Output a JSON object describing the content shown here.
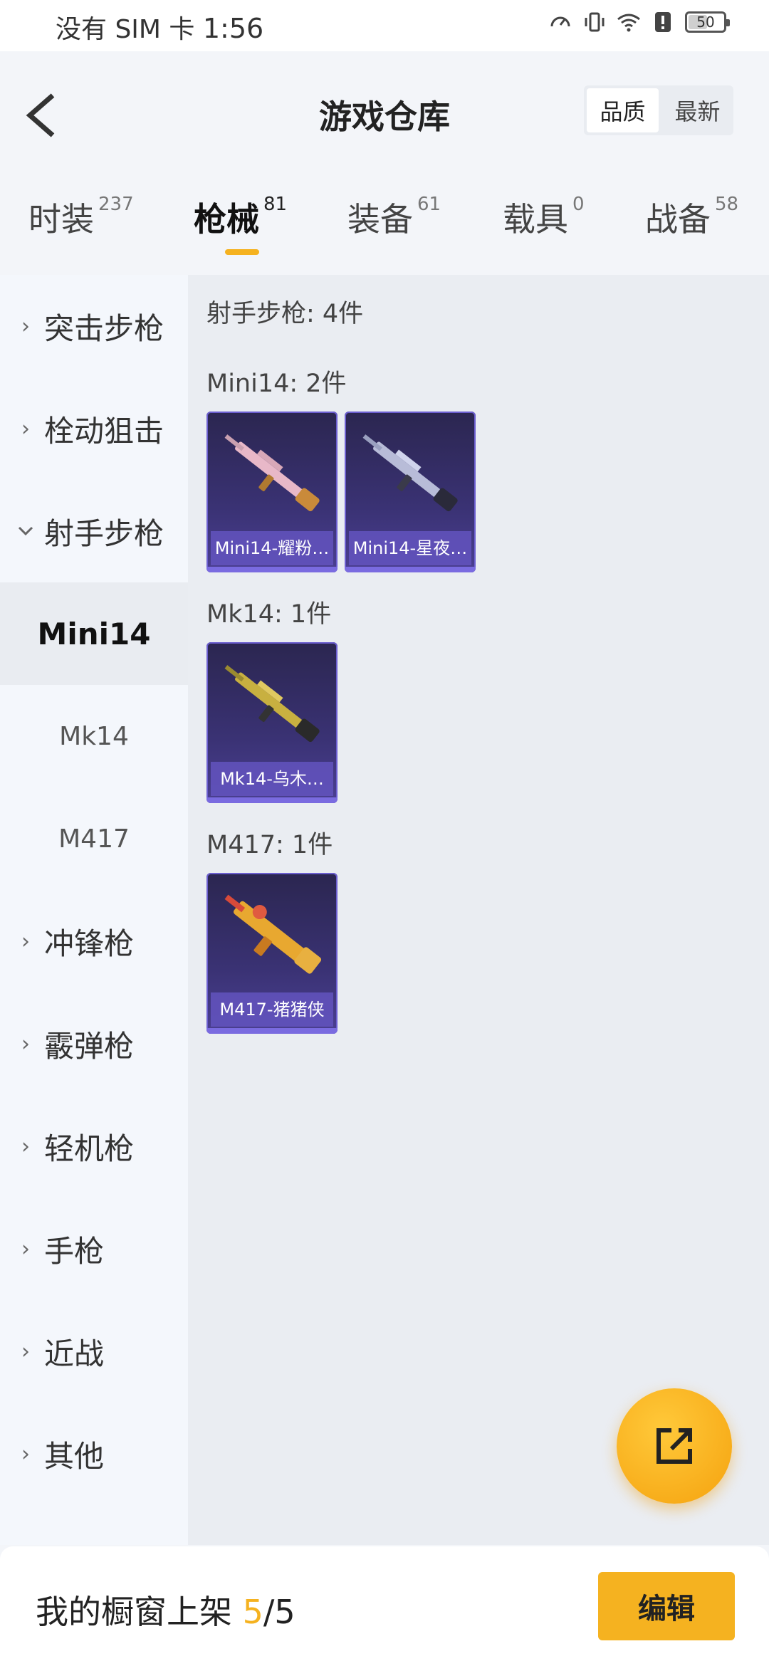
{
  "status_bar": {
    "carrier": "没有 SIM 卡",
    "time": "1:56",
    "battery": "50",
    "icons": [
      "speed-icon",
      "vibrate-icon",
      "wifi-icon",
      "alert-icon"
    ]
  },
  "header": {
    "title": "游戏仓库",
    "sort_options": [
      "品质",
      "最新"
    ],
    "sort_selected": "品质"
  },
  "tabs": [
    {
      "label": "时装",
      "count": "237"
    },
    {
      "label": "枪械",
      "count": "81",
      "active": true
    },
    {
      "label": "装备",
      "count": "61"
    },
    {
      "label": "载具",
      "count": "0"
    },
    {
      "label": "战备",
      "count": "58"
    }
  ],
  "sidebar": {
    "items": [
      {
        "label": "突击步枪",
        "expanded": false
      },
      {
        "label": "栓动狙击",
        "expanded": false
      },
      {
        "label": "射手步枪",
        "expanded": true
      },
      {
        "label": "冲锋枪",
        "expanded": false
      },
      {
        "label": "霰弹枪",
        "expanded": false
      },
      {
        "label": "轻机枪",
        "expanded": false
      },
      {
        "label": "手枪",
        "expanded": false
      },
      {
        "label": "近战",
        "expanded": false
      },
      {
        "label": "其他",
        "expanded": false
      }
    ],
    "sub_items": [
      {
        "label": "Mini14",
        "active": true
      },
      {
        "label": "Mk14"
      },
      {
        "label": "M417"
      }
    ]
  },
  "content": {
    "summary": "射手步枪: 4件",
    "groups": [
      {
        "title": "Mini14: 2件",
        "items": [
          "Mini14-耀粉…",
          "Mini14-星夜…"
        ]
      },
      {
        "title": "Mk14: 1件",
        "items": [
          "Mk14-乌木…"
        ]
      },
      {
        "title": "M417: 1件",
        "items": [
          "M417-猪猪侠"
        ]
      }
    ]
  },
  "bottom": {
    "shelf_label": "我的橱窗上架",
    "shelf_current": "5",
    "shelf_total": "/5",
    "edit_label": "编辑"
  },
  "colors": {
    "accent": "#f5b220",
    "card_bg": "#3a3274",
    "card_caption": "#6353be"
  }
}
